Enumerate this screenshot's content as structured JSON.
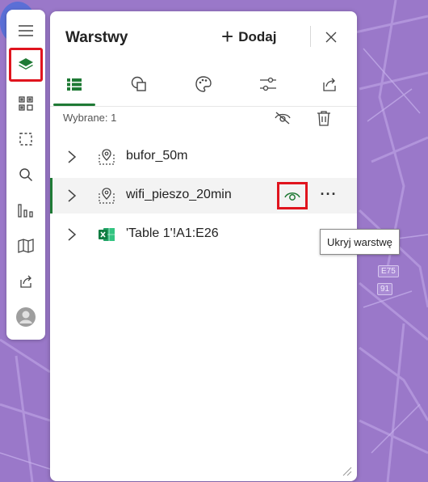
{
  "panel": {
    "title": "Warstwy",
    "add_label": "Dodaj",
    "selected_label": "Wybrane: 1"
  },
  "layers": [
    {
      "name": "bufor_50m",
      "icon": "map-pin-layer-icon"
    },
    {
      "name": "wifi_pieszo_20min",
      "icon": "map-pin-layer-icon"
    },
    {
      "name": "'Table 1'!A1:E26",
      "icon": "excel-icon"
    }
  ],
  "tooltip": "Ukryj warstwę",
  "map": {
    "badge_1": "E75",
    "badge_2": "91"
  },
  "colors": {
    "accent": "#1f7a35",
    "highlight": "#e0141e",
    "map_bg": "#9a78c9",
    "pin": "#5b6fd6"
  }
}
